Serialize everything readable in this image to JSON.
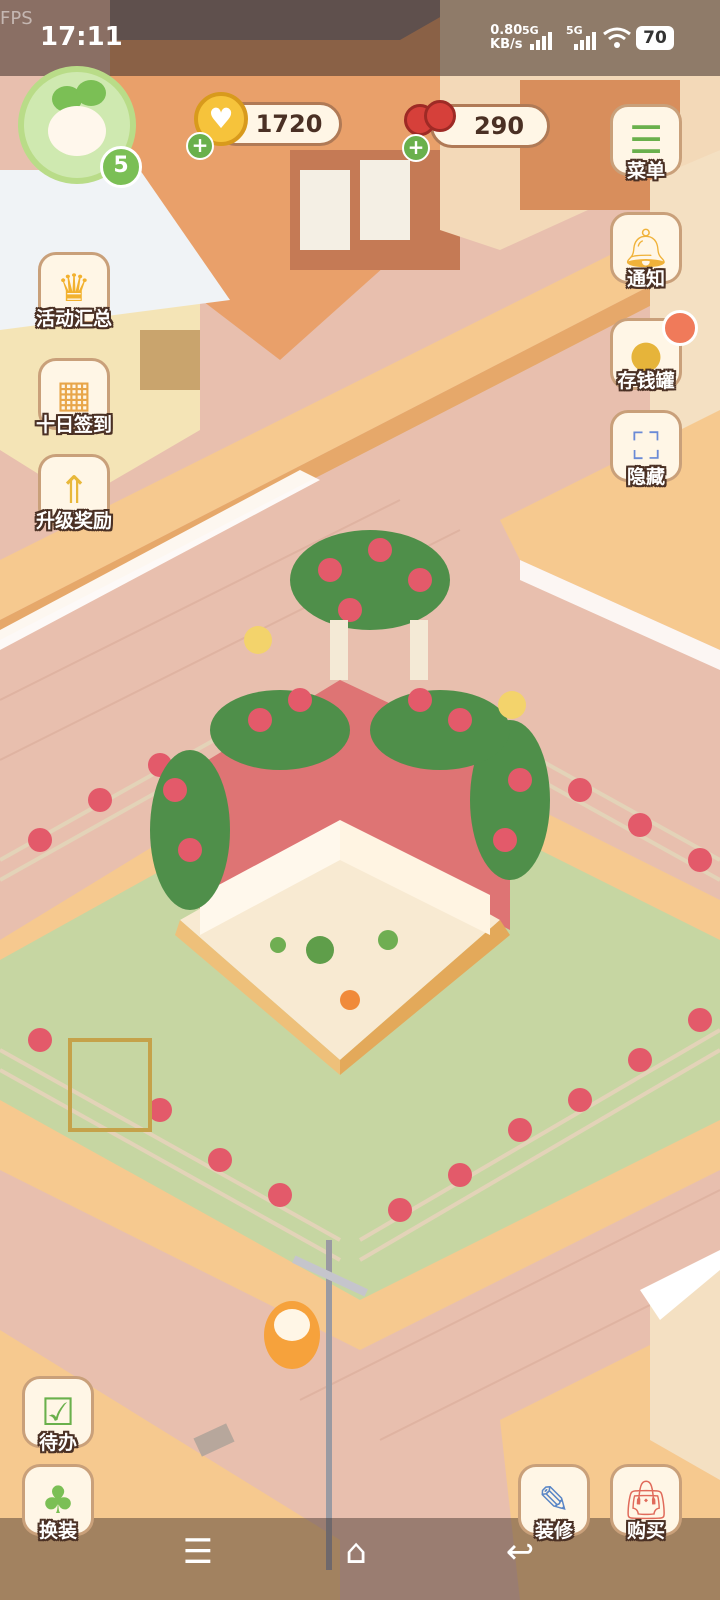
{
  "status_bar": {
    "time": "17:11",
    "fps_label": "FPS",
    "net_speed_value": "0.80",
    "net_speed_unit": "KB/s",
    "signal1_label": "5G",
    "signal2_label": "5G",
    "battery": "70"
  },
  "player": {
    "level": "5"
  },
  "resources": {
    "coins": "1720",
    "cherries": "290"
  },
  "left_menu": [
    {
      "label": "活动汇总",
      "icon": "crown-icon"
    },
    {
      "label": "十日签到",
      "icon": "calendar-icon"
    },
    {
      "label": "升级奖励",
      "icon": "upgrade-arrows-icon"
    }
  ],
  "right_menu": [
    {
      "label": "菜单",
      "icon": "menu-list-icon"
    },
    {
      "label": "通知",
      "icon": "bell-icon"
    },
    {
      "label": "存钱罐",
      "icon": "piggy-bank-icon"
    },
    {
      "label": "隐藏",
      "icon": "hide-frame-icon"
    }
  ],
  "bottom_left": [
    {
      "label": "待办",
      "icon": "todo-list-icon"
    },
    {
      "label": "换装",
      "icon": "outfit-icon"
    }
  ],
  "bottom_right": [
    {
      "label": "装修",
      "icon": "decorate-icon"
    },
    {
      "label": "购买",
      "icon": "shopping-bag-icon"
    }
  ],
  "nav_bar": {
    "menu_icon": "menu-icon",
    "home_icon": "home-icon",
    "back_icon": "back-icon"
  },
  "colors": {
    "grass": "#c6d6a2",
    "sidewalk": "#f6c98f",
    "road": "#e8bfae",
    "wall_red": "#de7474",
    "accent_green": "#7bbf55"
  }
}
